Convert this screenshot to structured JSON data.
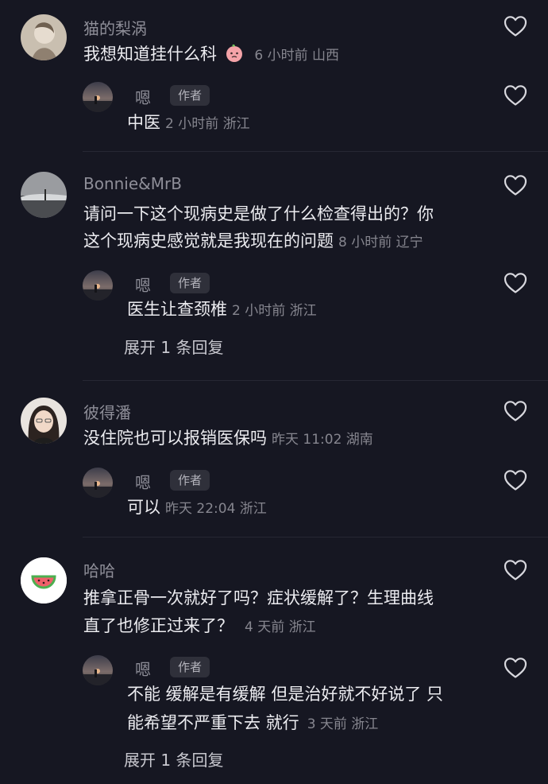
{
  "comments": [
    {
      "user": "猫的梨涡",
      "text": "我想知道挂什么科",
      "emoji": "peach-face-emoji",
      "meta": "6 小时前 山西",
      "reply": {
        "user": "嗯",
        "badge": "作者",
        "text": "中医",
        "meta": "2 小时前 浙江"
      }
    },
    {
      "user": "Bonnie&MrB",
      "text_line1": "请问一下这个现病史是做了什么检查得出的？你",
      "text_line2": "这个现病史感觉就是我现在的问题",
      "meta": "8 小时前 辽宁",
      "reply": {
        "user": "嗯",
        "badge": "作者",
        "text": "医生让查颈椎",
        "meta": "2 小时前 浙江"
      },
      "expand": "展开 1 条回复"
    },
    {
      "user": "彼得潘",
      "text": "没住院也可以报销医保吗",
      "meta": "昨天 11:02 湖南",
      "reply": {
        "user": "嗯",
        "badge": "作者",
        "text": "可以",
        "meta": "昨天 22:04 浙江"
      }
    },
    {
      "user": "哈哈",
      "text_line1": "推拿正骨一次就好了吗？症状缓解了？生理曲线",
      "text_line2": "直了也修正过来了？",
      "meta": "4 天前 浙江",
      "reply": {
        "user": "嗯",
        "badge": "作者",
        "text_line1": "不能 缓解是有缓解 但是治好就不好说了 只",
        "text_line2": "能希望不严重下去 就行",
        "meta": "3 天前 浙江"
      },
      "expand": "展开 1 条回复"
    }
  ],
  "colors": {
    "background": "#161722",
    "muted": "#86868f",
    "text": "#ececf0"
  },
  "icons": {
    "like": "heart-outline-icon"
  }
}
